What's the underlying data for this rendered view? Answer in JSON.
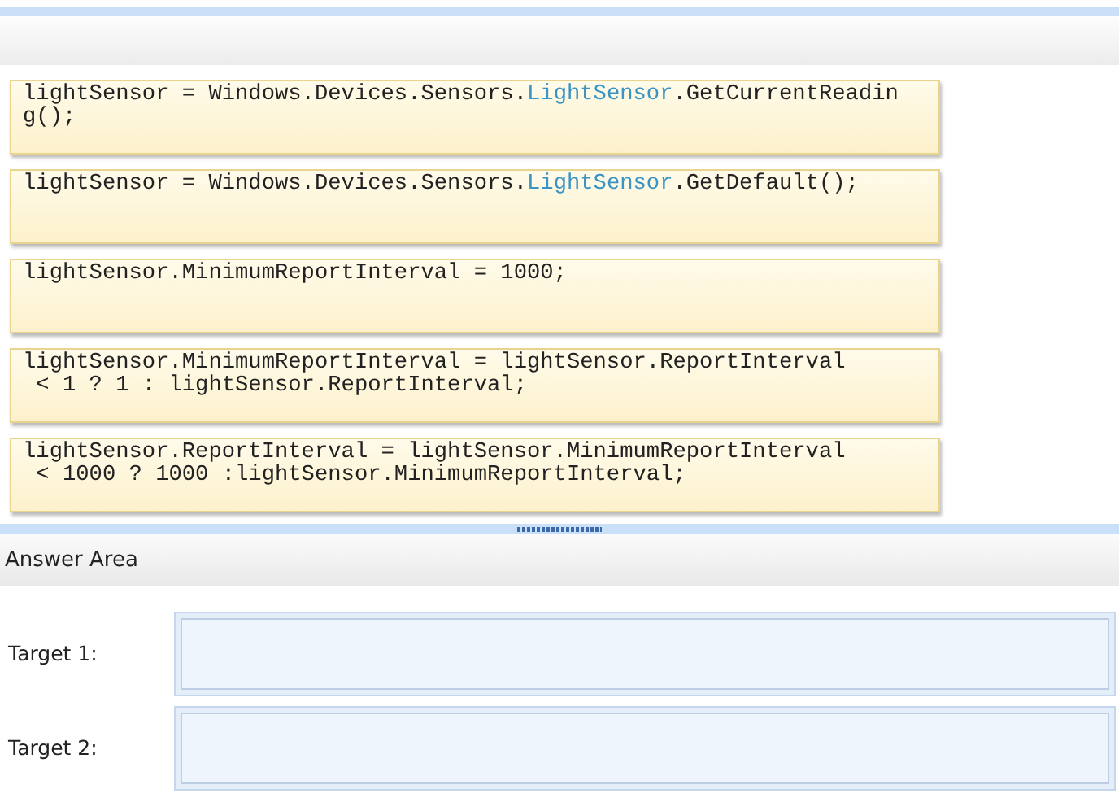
{
  "code_tiles": [
    {
      "lines": [
        [
          {
            "text": "lightSensor = Windows.Devices.Sensors.",
            "kind": "plain"
          },
          {
            "text": "LightSensor",
            "kind": "type"
          },
          {
            "text": ".GetCurrentReadin",
            "kind": "plain"
          }
        ],
        [
          {
            "text": "g();",
            "kind": "plain"
          }
        ]
      ]
    },
    {
      "lines": [
        [
          {
            "text": "lightSensor = Windows.Devices.Sensors.",
            "kind": "plain"
          },
          {
            "text": "LightSensor",
            "kind": "type"
          },
          {
            "text": ".GetDefault();",
            "kind": "plain"
          }
        ]
      ]
    },
    {
      "lines": [
        [
          {
            "text": "lightSensor.MinimumReportInterval = 1000;",
            "kind": "plain"
          }
        ]
      ]
    },
    {
      "lines": [
        [
          {
            "text": "lightSensor.MinimumReportInterval = lightSensor.ReportInterval",
            "kind": "plain"
          }
        ],
        [
          {
            "text": " < 1 ? 1 : lightSensor.ReportInterval;",
            "kind": "plain"
          }
        ]
      ]
    },
    {
      "lines": [
        [
          {
            "text": "lightSensor.ReportInterval = lightSensor.MinimumReportInterval",
            "kind": "plain"
          }
        ],
        [
          {
            "text": " < 1000 ? 1000 :lightSensor.MinimumReportInterval;",
            "kind": "plain"
          }
        ]
      ]
    }
  ],
  "answer_area": {
    "title": "Answer Area",
    "targets": [
      {
        "label": "Target 1:"
      },
      {
        "label": "Target 2:"
      }
    ]
  }
}
